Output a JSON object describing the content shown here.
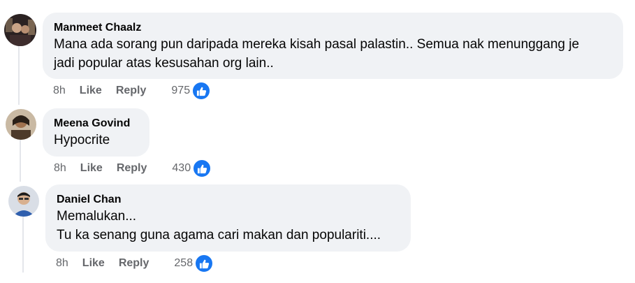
{
  "comments": [
    {
      "author": "Manmeet Chaalz",
      "lines": [
        "Mana ada sorang pun daripada mereka kisah pasal palastin.. Semua nak menunggang je",
        "jadi popular atas kesusahan org lain.."
      ],
      "time": "8h",
      "like_label": "Like",
      "reply_label": "Reply",
      "reaction_count": "975"
    },
    {
      "author": "Meena Govind",
      "lines": [
        "Hypocrite"
      ],
      "time": "8h",
      "like_label": "Like",
      "reply_label": "Reply",
      "reaction_count": "430"
    },
    {
      "author": "Daniel Chan",
      "lines": [
        "Memalukan...",
        "Tu ka senang guna agama cari makan dan populariti...."
      ],
      "time": "8h",
      "like_label": "Like",
      "reply_label": "Reply",
      "reaction_count": "258"
    }
  ],
  "icons": {
    "reaction": "thumbs-up-icon"
  },
  "colors": {
    "bubble_bg": "#f0f2f5",
    "meta_text": "#65676b",
    "like_blue": "#1877f2",
    "thread_line": "#e4e6eb"
  }
}
